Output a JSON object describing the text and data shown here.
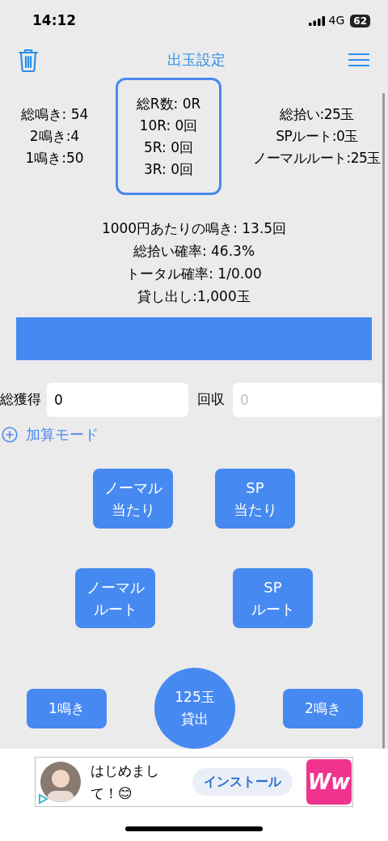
{
  "status_bar": {
    "time": "14:12",
    "network": "4G",
    "battery": "62"
  },
  "nav": {
    "title": "出玉設定"
  },
  "left_stats": [
    "総鳴き: 54",
    "2鳴き:4",
    "1鳴き:50"
  ],
  "round_box": [
    "総R数: 0R",
    "10R: 0回",
    "5R: 0回",
    "3R: 0回"
  ],
  "right_stats": [
    "総拾い:25玉",
    "SPルート:0玉",
    "ノーマルルート:25玉"
  ],
  "summary": [
    "1000円あたりの鳴き: 13.5回",
    "総拾い確率: 46.3%",
    "トータル確率: 1/0.00",
    "貸し出し:1,000玉"
  ],
  "fields": [
    {
      "label": "総獲得",
      "value": "0"
    },
    {
      "label": "回収",
      "placeholder": "0"
    }
  ],
  "mode_link": "加算モード",
  "button_rows": [
    [
      [
        "ノーマル",
        "当たり"
      ],
      [
        "SP",
        "当たり"
      ]
    ],
    [
      [
        "ノーマル",
        "ルート"
      ],
      [
        "SP",
        "ルート"
      ]
    ]
  ],
  "bottom_buttons": [
    {
      "kind": "rect",
      "label": [
        "1鳴き"
      ]
    },
    {
      "kind": "circle",
      "label": [
        "125玉",
        "貸出"
      ]
    },
    {
      "kind": "rect",
      "label": [
        "2鳴き"
      ]
    }
  ],
  "ad": {
    "text": "はじめまして！😊",
    "button": "インストール",
    "app_icon": "Ww"
  }
}
